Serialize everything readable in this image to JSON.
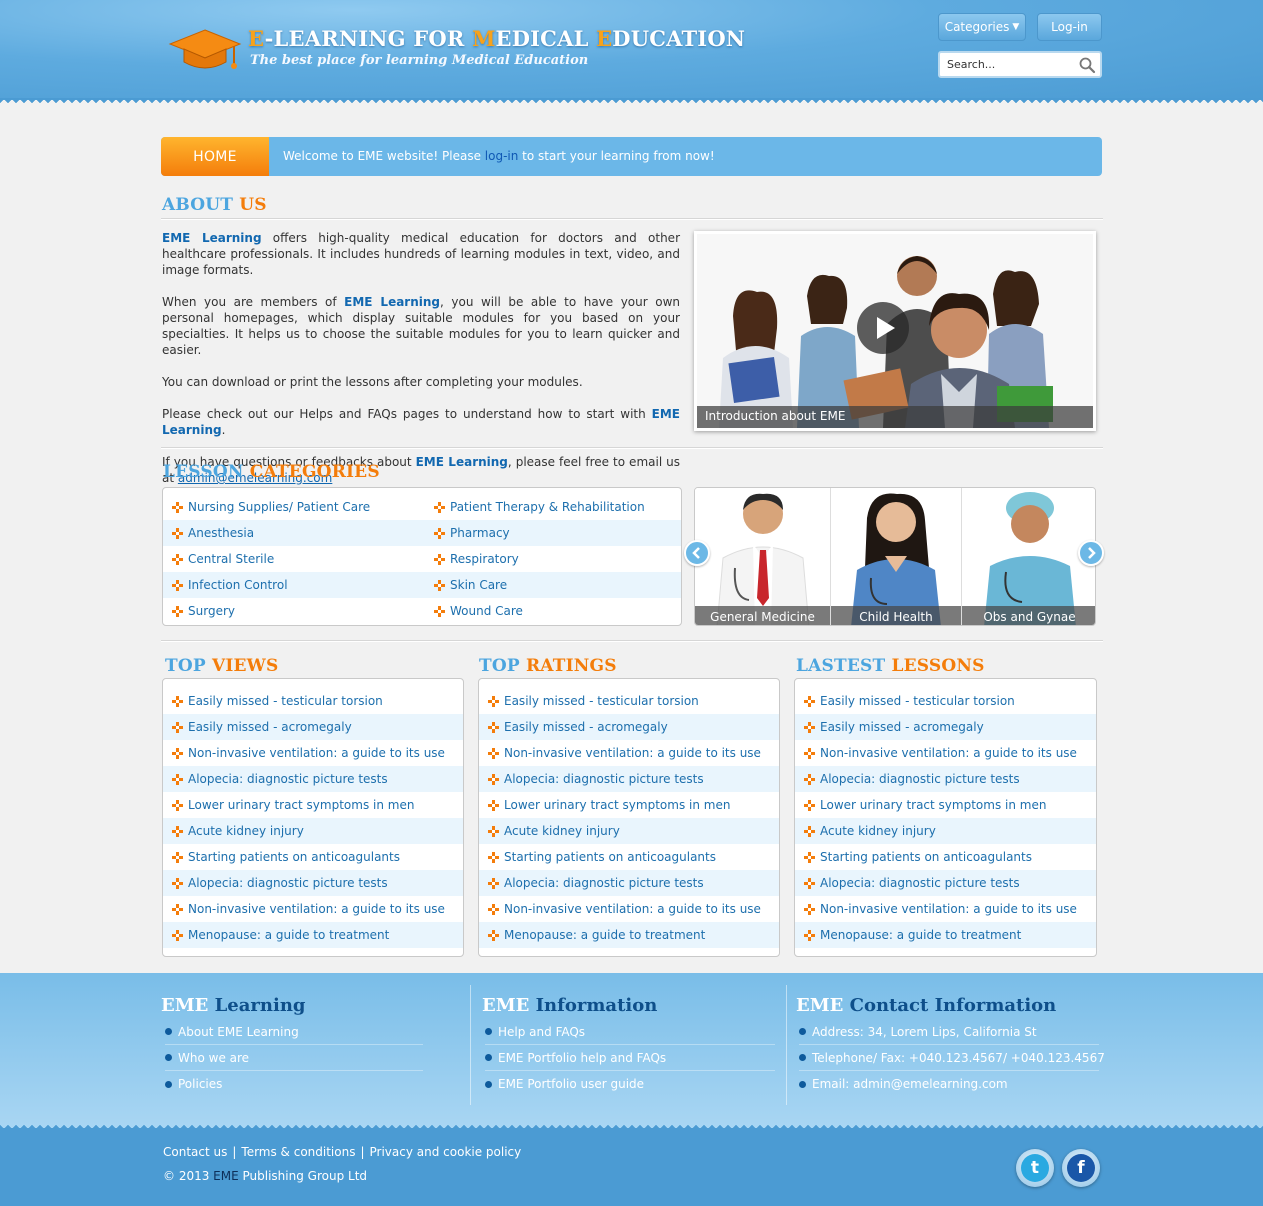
{
  "header": {
    "title_parts": [
      {
        "text": "E",
        "hl": true
      },
      {
        "text": "-LEARNING FOR ",
        "hl": false
      },
      {
        "text": "M",
        "hl": true
      },
      {
        "text": "EDICAL ",
        "hl": false
      },
      {
        "text": "E",
        "hl": true
      },
      {
        "text": "DUCATION",
        "hl": false
      }
    ],
    "tagline": "The best place for learning Medical Education",
    "categories_label": "Categories",
    "login_label": "Log-in",
    "search_placeholder": "Search..."
  },
  "navbar": {
    "home_label": "HOME",
    "welcome_prefix": "Welcome to EME website! Please ",
    "welcome_link": "log-in",
    "welcome_suffix": " to start your learning from now!"
  },
  "about": {
    "title_a": "ABOUT ",
    "title_b": "US",
    "p1_brand": "EME Learning",
    "p1_text": " offers high-quality medical education for doctors and other healthcare professionals. It includes hundreds of learning modules in text, video, and image formats.",
    "p2_pre": "When you are members of ",
    "p2_brand": "EME Learning",
    "p2_text": ", you will be able to have your own personal homepages, which display suitable modules for you based on your specialties. It helps us to choose the suitable modules for you to learn quicker and easier.",
    "p3_text": "You can download or print the lessons after completing your modules.",
    "p4_pre": "Please check out our Helps and FAQs pages to understand how to start with ",
    "p4_brand": "EME Learning",
    "p4_post": ".",
    "p5_pre": "If you have questions or feedbacks about ",
    "p5_brand": "EME Learning",
    "p5_text": ", please feel free to email us at ",
    "email": "admin@emelearning.com",
    "video_caption": "Introduction about EME"
  },
  "categories": {
    "title_a": "LESSON ",
    "title_b": "CATEGORIES",
    "col1": [
      "Nursing Supplies/ Patient Care",
      "Anesthesia",
      "Central Sterile",
      "Infection Control",
      "Surgery"
    ],
    "col2": [
      "Patient Therapy & Rehabilitation",
      "Pharmacy",
      "Respiratory",
      "Skin Care",
      "Wound Care"
    ],
    "carousel": [
      "General Medicine",
      "Child Health",
      "Obs and Gynae"
    ]
  },
  "top_views": {
    "title_a": "TOP ",
    "title_b": "VIEWS",
    "items": [
      "Easily missed - testicular torsion",
      "Easily missed - acromegaly",
      "Non-invasive ventilation: a guide to its use",
      "Alopecia: diagnostic picture tests",
      "Lower urinary tract symptoms in men",
      "Acute kidney injury",
      "Starting patients on anticoagulants",
      "Alopecia: diagnostic picture tests",
      "Non-invasive ventilation: a guide to its use",
      "Menopause: a guide to treatment"
    ]
  },
  "top_ratings": {
    "title_a": "TOP ",
    "title_b": "RATINGS",
    "items": [
      "Easily missed - testicular torsion",
      "Easily missed - acromegaly",
      "Non-invasive ventilation: a guide to its use",
      "Alopecia: diagnostic picture tests",
      "Lower urinary tract symptoms in men",
      "Acute kidney injury",
      "Starting patients on anticoagulants",
      "Alopecia: diagnostic picture tests",
      "Non-invasive ventilation: a guide to its use",
      "Menopause: a guide to treatment"
    ]
  },
  "latest_lessons": {
    "title_a": "LASTEST ",
    "title_b": "LESSONS",
    "items": [
      "Easily missed - testicular torsion",
      "Easily missed - acromegaly",
      "Non-invasive ventilation: a guide to its use",
      "Alopecia: diagnostic picture tests",
      "Lower urinary tract symptoms in men",
      "Acute kidney injury",
      "Starting patients on anticoagulants",
      "Alopecia: diagnostic picture tests",
      "Non-invasive ventilation: a guide to its use",
      "Menopause: a guide to treatment"
    ]
  },
  "footer": {
    "col1": {
      "title_a": "EME ",
      "title_b": "Learning",
      "items": [
        "About EME Learning",
        "Who we are",
        "Policies"
      ]
    },
    "col2": {
      "title_a": "EME ",
      "title_b": "Information",
      "items": [
        "Help and FAQs",
        "EME Portfolio help and FAQs",
        "EME Portfolio user guide"
      ]
    },
    "col3": {
      "title_a": "EME ",
      "title_b": "Contact Information",
      "items": [
        "Address: 34, Lorem Lips, California St",
        "Telephone/ Fax: +040.123.4567/ +040.123.4567",
        "Email: admin@emelearning.com"
      ]
    },
    "links": [
      "Contact us",
      "Terms & conditions",
      "Privacy and cookie policy"
    ],
    "copyright_pre": "© 2013 ",
    "copyright_brand": "EME",
    "copyright_post": " Publishing Group Ltd",
    "social": [
      {
        "icon": "twitter-icon",
        "glyph": "t",
        "color": "#29a9e1"
      },
      {
        "icon": "facebook-icon",
        "glyph": "f",
        "color": "#1a57a8"
      }
    ]
  },
  "colors": {
    "accent_blue": "#4ca5df",
    "accent_orange": "#f47d0b",
    "link_blue": "#1d6fad"
  }
}
